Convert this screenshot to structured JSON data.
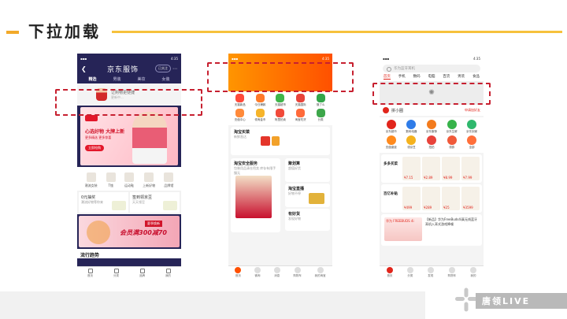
{
  "slide": {
    "title": "下拉加载",
    "logo_text": "唐领LIVE"
  },
  "colors": {
    "accent": "#f6c13c",
    "dash": "#c72030",
    "jd_red": "#e1251b",
    "taobao_orange": "#ff5000"
  },
  "phone1": {
    "status_time": "4:35",
    "title": "京东服饰",
    "pill": "已关注",
    "tabs": [
      "精选",
      "男装",
      "美妆",
      "女装"
    ],
    "refresh": {
      "line1": "让购物更便捷",
      "line2": "更新中..."
    },
    "banner": {
      "headline": "心选好物 大牌上新",
      "sub": "更多精选 更多惊喜",
      "btn": "立即抢购"
    },
    "cats": [
      "潮流女装",
      "T恤",
      "运动鞋",
      "上新好物",
      "品牌馆"
    ],
    "box1": {
      "title": "0元抽奖",
      "sub": "潮流好物等你来"
    },
    "box2": {
      "title": "签到领京豆",
      "sub": "天天领豆"
    },
    "promo": {
      "tag": "夏季焕新",
      "headline": "会员满300减70"
    },
    "trend": "流行趋势",
    "nav": [
      "首页",
      "分类",
      "品牌",
      "我的"
    ]
  },
  "phone2": {
    "status_time": "4:35",
    "grid_row1": [
      "天猫新品",
      "今日爆款",
      "天猫超市",
      "天猫国际",
      "饿了么"
    ],
    "grid_row2": [
      "充值中心",
      "领淘金币",
      "阿里拍卖",
      "淘宝吃货",
      "分类"
    ],
    "cards": [
      {
        "title": "淘宝买菜",
        "sub": "新鲜直达"
      },
      {
        "title": "聚划算",
        "sub": "超值好货"
      },
      {
        "title": "淘宝安全服务",
        "sub": "包装用品清仓甩卖"
      },
      {
        "title": "淘宝直播",
        "sub": "好物不停"
      },
      {
        "title": "有好货",
        "sub": "发现好物"
      }
    ],
    "promo_text": "包装用品清仓甩卖 库存有限手慢无",
    "nav": [
      "首页",
      "微淘",
      "消息",
      "购物车",
      "我的淘宝"
    ]
  },
  "phone3": {
    "status_time": "4:35",
    "search_placeholder": "华为蓝牙耳机",
    "tabs": [
      "首页",
      "手机",
      "数码",
      "电脑",
      "百货",
      "男装",
      "食品"
    ],
    "loader_icon": "spinner-icon",
    "member": {
      "name": "拼小圈",
      "join": "申请加好友"
    },
    "grid_row1": [
      "京东超市",
      "数码电器",
      "京东服饰",
      "京东生鲜",
      "京东到家"
    ],
    "grid_row2": [
      "充值缴费",
      "领京豆",
      "拍拍",
      "领券",
      "全部"
    ],
    "seg1": {
      "label": "多多买菜",
      "prices": [
        "¥7.15",
        "¥2.89",
        "¥8.99",
        "¥7.99"
      ]
    },
    "seg2": {
      "label": "百亿补贴",
      "prices": [
        "¥499",
        "¥289",
        "¥25",
        "¥3599"
      ]
    },
    "ad": {
      "box": "华为 FREEBUDS 4i",
      "text": "【新品】华为FreeBuds4i真无线蓝牙耳机入耳式游戏降噪"
    },
    "nav": [
      "首页",
      "分类",
      "发现",
      "购物车",
      "我的"
    ]
  }
}
